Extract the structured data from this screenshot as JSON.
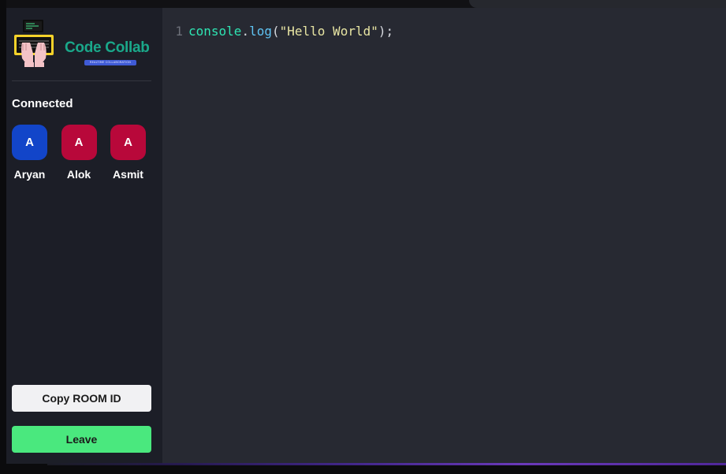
{
  "app": {
    "logo_title": "Code Collab",
    "logo_subtitle": "REALTIME COLLABORATION"
  },
  "sidebar": {
    "connected_label": "Connected",
    "clients": [
      {
        "initial": "A",
        "name": "Aryan",
        "color": "#1245c9"
      },
      {
        "initial": "A",
        "name": "Alok",
        "color": "#b8083a"
      },
      {
        "initial": "A",
        "name": "Asmit",
        "color": "#b8083a"
      }
    ],
    "copy_room_label": "Copy ROOM ID",
    "leave_label": "Leave"
  },
  "editor": {
    "line_number": "1",
    "tokens": {
      "obj": "console",
      "dot": ".",
      "fn": "log",
      "open": "(",
      "str": "\"Hello World\"",
      "close": ");"
    }
  },
  "colors": {
    "sidebar_bg": "#1c1e27",
    "editor_bg": "#272932",
    "leave_button": "#4ae87e",
    "copy_button": "#f1f1f3",
    "brand": "#1aa88a"
  }
}
